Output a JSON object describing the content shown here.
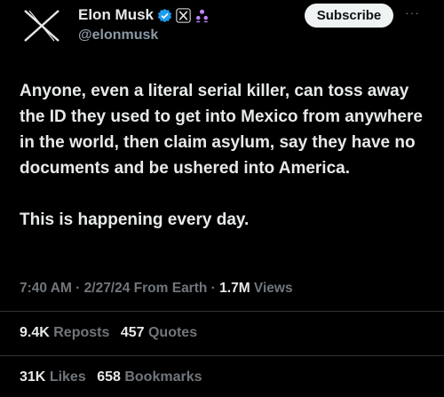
{
  "tweet": {
    "author": {
      "name": "Elon Musk",
      "handle": "@elonmusk"
    },
    "subscribe_label": "Subscribe",
    "more_label": "···",
    "paragraphs": [
      "Anyone, even a literal serial killer, can toss away the ID they used to get into Mexico from anywhere in the world, then claim asylum, say they have no documents and be ushered into America.",
      "This is happening every day."
    ],
    "meta": {
      "time": "7:40 AM",
      "sep": " · ",
      "date": "2/27/24",
      "source": "From Earth",
      "views_count": "1.7M",
      "views_label": "Views"
    },
    "stats": {
      "reposts_count": "9.4K",
      "reposts_label": "Reposts",
      "quotes_count": "457",
      "quotes_label": "Quotes",
      "likes_count": "31K",
      "likes_label": "Likes",
      "bookmarks_count": "658",
      "bookmarks_label": "Bookmarks"
    }
  },
  "icons": {
    "avatar": "x-logo-icon",
    "verified": "verified-badge-icon",
    "affiliate": "x-affiliate-badge-icon",
    "extra": "purple-people-icon"
  },
  "colors": {
    "background": "#000000",
    "text": "#e7e9ea",
    "muted": "#71767b",
    "verified": "#1d9bf0",
    "affiliate_purple": "#c084fc"
  }
}
